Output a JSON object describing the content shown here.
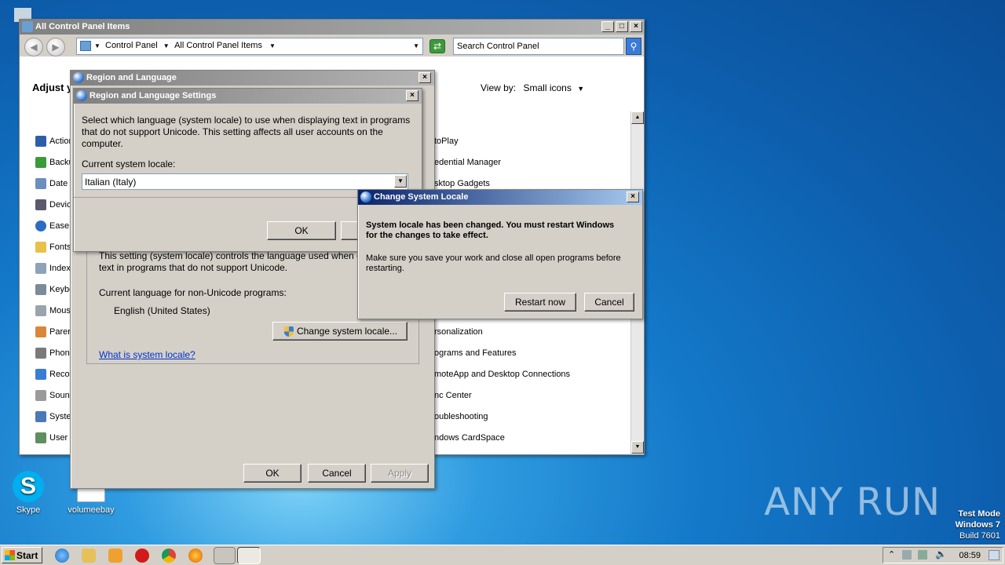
{
  "desktop": {
    "icons": [
      {
        "label": "Skype"
      },
      {
        "label": "volumeebay"
      }
    ],
    "watermark": "ANY RUN",
    "test_mode": [
      "Test Mode",
      "Windows 7",
      "Build 7601"
    ]
  },
  "control_panel": {
    "title": "All Control Panel Items",
    "breadcrumb": [
      "Control Panel",
      "All Control Panel Items"
    ],
    "search_placeholder": "Search Control Panel",
    "heading": "Adjust y",
    "view_by_label": "View by:",
    "view_by_value": "Small icons",
    "left_items": [
      "Action",
      "Backu",
      "Date",
      "Device",
      "Ease",
      "Fonts",
      "Index",
      "Keybo",
      "Mouse",
      "Parer",
      "Phone",
      "Recov",
      "Sound",
      "Syste",
      "User"
    ],
    "right_items": [
      "toPlay",
      "edential Manager",
      "sktop Gadgets",
      "rsonalization",
      "ograms and Features",
      "moteApp and Desktop Connections",
      "nc Center",
      "oubleshooting",
      "ndows CardSpace"
    ]
  },
  "region_language": {
    "title": "Region and Language",
    "description": [
      "This setting (system locale) controls the language used when d",
      "text in programs that do not support Unicode."
    ],
    "current_label": "Current language for non-Unicode programs:",
    "current_value": "English (United States)",
    "change_button": "Change system locale...",
    "help_link": "What is system locale?",
    "ok": "OK",
    "cancel": "Cancel",
    "apply": "Apply"
  },
  "region_settings": {
    "title": "Region and Language Settings",
    "description": [
      "Select which language (system locale) to use when displaying text in programs",
      "that do not support Unicode. This setting affects all user accounts on the",
      "computer."
    ],
    "locale_label": "Current system locale:",
    "locale_value": "Italian (Italy)",
    "ok": "OK"
  },
  "change_locale": {
    "title": "Change System Locale",
    "message_bold": [
      "System locale has been changed. You must restart Windows",
      "for the changes to take effect."
    ],
    "message": [
      "Make sure you save your work and close all open programs before",
      "restarting."
    ],
    "restart_button": "Restart now",
    "cancel_button": "Cancel"
  },
  "taskbar": {
    "start_label": "Start",
    "clock": "08:59"
  }
}
